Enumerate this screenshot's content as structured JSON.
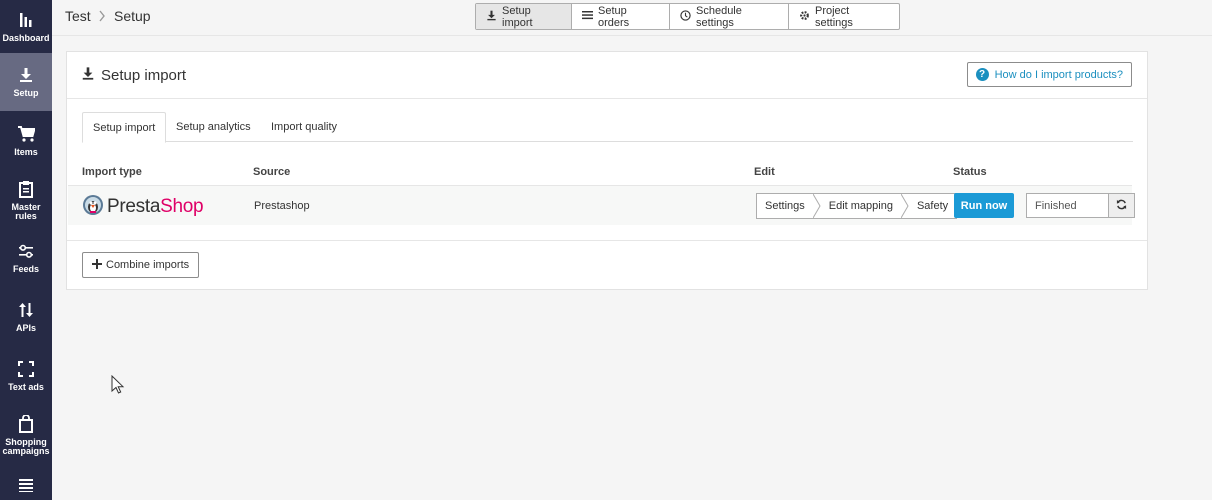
{
  "sidebar": {
    "items": [
      {
        "label": "Dashboard",
        "icon": "bar-chart-icon"
      },
      {
        "label": "Setup",
        "icon": "download-icon"
      },
      {
        "label": "Items",
        "icon": "cart-icon"
      },
      {
        "label": "Master rules",
        "icon": "clipboard-icon"
      },
      {
        "label": "Feeds",
        "icon": "sliders-icon"
      },
      {
        "label": "APIs",
        "icon": "arrows-updown-icon"
      },
      {
        "label": "Text ads",
        "icon": "expand-icon"
      },
      {
        "label": "Shopping campaigns",
        "icon": "shopping-bag-icon"
      },
      {
        "label": "",
        "icon": "menu-icon"
      }
    ],
    "active_color": "#676a82",
    "bg_color": "#262a45"
  },
  "breadcrumb": {
    "project": "Test",
    "page": "Setup"
  },
  "top_tabs": [
    {
      "label": "Setup import",
      "icon": "download-icon"
    },
    {
      "label": "Setup orders",
      "icon": "list-icon"
    },
    {
      "label": "Schedule settings",
      "icon": "clock-icon"
    },
    {
      "label": "Project settings",
      "icon": "gear-icon"
    }
  ],
  "card": {
    "title": "Setup import",
    "help_label": "How do I import products?",
    "tabs": [
      "Setup import",
      "Setup analytics",
      "Import quality"
    ],
    "columns": {
      "import_type": "Import type",
      "source": "Source",
      "edit": "Edit",
      "status": "Status"
    },
    "row": {
      "logo_presta": "Presta",
      "logo_shop": "Shop",
      "source": "Prestashop",
      "edit_steps": [
        "Settings",
        "Edit mapping",
        "Safety"
      ],
      "run_label": "Run now",
      "status": "Finished"
    },
    "combine_label": "Combine imports"
  },
  "colors": {
    "accent": "#1b9ad6",
    "brand_shop": "#df0067"
  }
}
